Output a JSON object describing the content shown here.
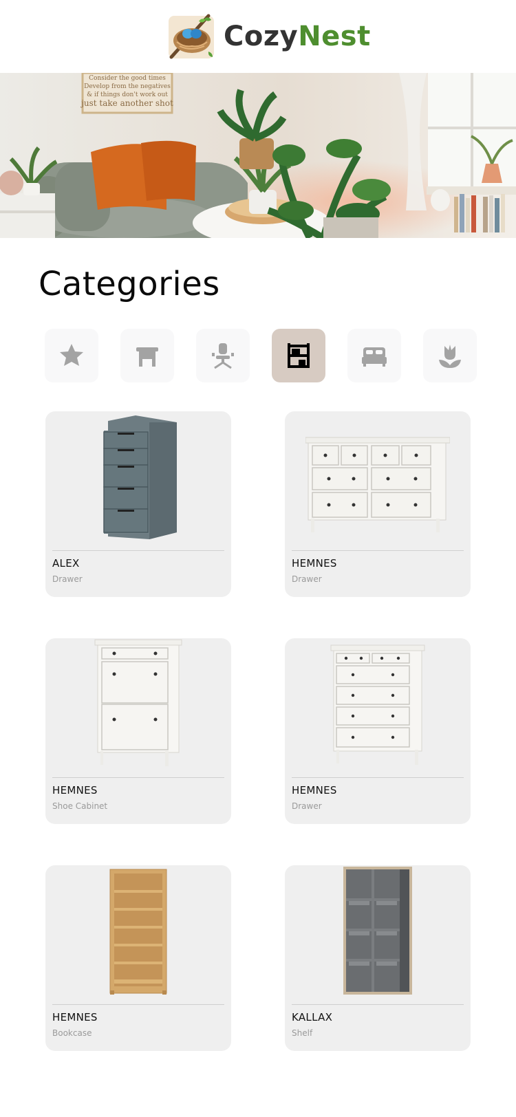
{
  "brand": {
    "part1": "Cozy",
    "part2": "Nest",
    "logo_icon": "bird-nest-icon",
    "color1": "#333333",
    "color2": "#4e8e2f"
  },
  "hero": {
    "sign_line1": "Consider the good times",
    "sign_line2": "Develop from the negatives",
    "sign_line3": "& if things don't work out",
    "sign_line4": "just take another shot"
  },
  "categories": {
    "title": "Categories",
    "items": [
      {
        "icon": "star-icon",
        "active": false
      },
      {
        "icon": "table-icon",
        "active": false
      },
      {
        "icon": "office-chair-icon",
        "active": false
      },
      {
        "icon": "storage-shelf-icon",
        "active": true
      },
      {
        "icon": "bed-icon",
        "active": false
      },
      {
        "icon": "tulip-icon",
        "active": false
      }
    ],
    "active_color": "#d7cbc2"
  },
  "products": [
    {
      "name": "ALEX",
      "type": "Drawer"
    },
    {
      "name": "HEMNES",
      "type": "Drawer"
    },
    {
      "name": "HEMNES",
      "type": "Shoe Cabinet"
    },
    {
      "name": "HEMNES",
      "type": "Drawer"
    },
    {
      "name": "HEMNES",
      "type": "Bookcase"
    },
    {
      "name": "KALLAX",
      "type": "Shelf"
    }
  ]
}
